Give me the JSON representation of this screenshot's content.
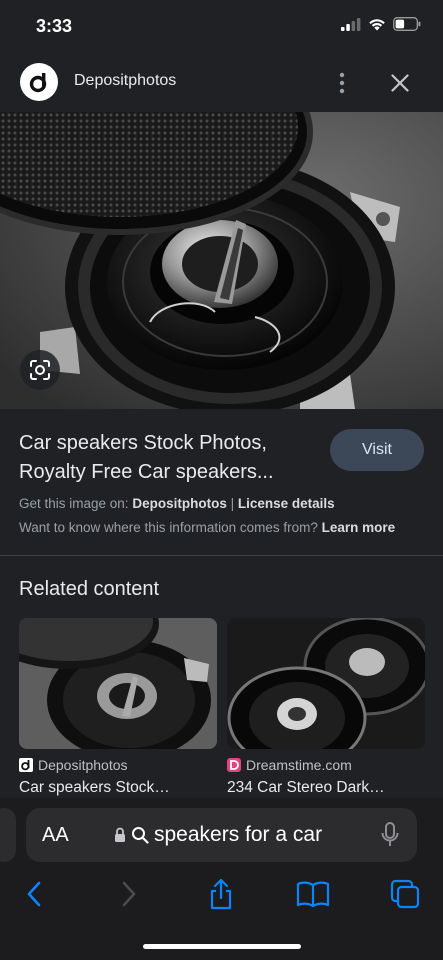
{
  "status_bar": {
    "time": "3:33"
  },
  "header": {
    "source_name": "Depositphotos",
    "logo_icon": "depositphotos-logo-icon",
    "more_icon": "more-vertical-icon",
    "close_icon": "close-icon"
  },
  "hero": {
    "image_description_icon": "car-speaker-photo",
    "lens_icon": "google-lens-icon"
  },
  "result": {
    "title": "Car speakers Stock Photos, Royalty Free Car speakers...",
    "visit_label": "Visit",
    "get_image_prefix": "Get this image on:",
    "get_image_source": "Depositphotos",
    "separator": "|",
    "license_details": "License details",
    "want_to_know": "Want to know where this information comes from?",
    "learn_more": "Learn more"
  },
  "related": {
    "heading": "Related content",
    "items": [
      {
        "source": "Depositphotos",
        "caption": "Car speakers Stock…",
        "source_icon": "depositphotos-logo-icon"
      },
      {
        "source": "Dreamstime.com",
        "caption": "234 Car Stereo Dark…",
        "source_icon": "dreamstime-logo-icon"
      }
    ]
  },
  "safari": {
    "aa_label": "AA",
    "address_text": "speakers for a car",
    "icons": [
      "lock-icon",
      "search-icon",
      "microphone-icon",
      "back-icon",
      "forward-icon",
      "share-icon",
      "bookmarks-icon",
      "tabs-icon"
    ]
  },
  "colors": {
    "background": "#202124",
    "visit_button": "#3c4757",
    "toolbar_accent": "#0a84ff"
  }
}
